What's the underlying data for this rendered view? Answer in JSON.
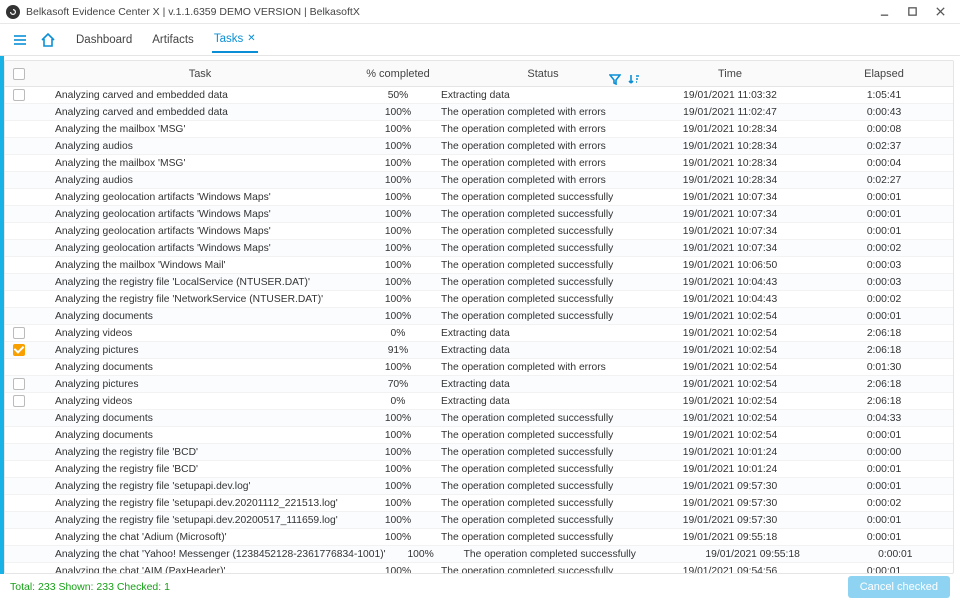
{
  "window": {
    "title": "Belkasoft Evidence Center X | v.1.1.6359 DEMO VERSION | BelkasoftX"
  },
  "tabs": {
    "dashboard": "Dashboard",
    "artifacts": "Artifacts",
    "tasks": "Tasks"
  },
  "columns": {
    "task": "Task",
    "pct": "% completed",
    "status": "Status",
    "time": "Time",
    "elapsed": "Elapsed"
  },
  "footer": {
    "stats": "Total: 233  Shown: 233  Checked: 1",
    "cancel": "Cancel checked"
  },
  "rows": [
    {
      "chk": "empty",
      "task": "Analyzing carved and embedded data",
      "pct": "50%",
      "status": "Extracting data",
      "time": "19/01/2021 11:03:32",
      "elapsed": "1:05:41"
    },
    {
      "chk": "none",
      "task": "Analyzing carved and embedded data",
      "pct": "100%",
      "status": "The operation completed with errors",
      "time": "19/01/2021 11:02:47",
      "elapsed": "0:00:43"
    },
    {
      "chk": "none",
      "task": "Analyzing the mailbox 'MSG'",
      "pct": "100%",
      "status": "The operation completed with errors",
      "time": "19/01/2021 10:28:34",
      "elapsed": "0:00:08"
    },
    {
      "chk": "none",
      "task": "Analyzing audios",
      "pct": "100%",
      "status": "The operation completed with errors",
      "time": "19/01/2021 10:28:34",
      "elapsed": "0:02:37"
    },
    {
      "chk": "none",
      "task": "Analyzing the mailbox 'MSG'",
      "pct": "100%",
      "status": "The operation completed with errors",
      "time": "19/01/2021 10:28:34",
      "elapsed": "0:00:04"
    },
    {
      "chk": "none",
      "task": "Analyzing audios",
      "pct": "100%",
      "status": "The operation completed with errors",
      "time": "19/01/2021 10:28:34",
      "elapsed": "0:02:27"
    },
    {
      "chk": "none",
      "task": "Analyzing geolocation artifacts 'Windows Maps'",
      "pct": "100%",
      "status": "The operation completed successfully",
      "time": "19/01/2021 10:07:34",
      "elapsed": "0:00:01"
    },
    {
      "chk": "none",
      "task": "Analyzing geolocation artifacts 'Windows Maps'",
      "pct": "100%",
      "status": "The operation completed successfully",
      "time": "19/01/2021 10:07:34",
      "elapsed": "0:00:01"
    },
    {
      "chk": "none",
      "task": "Analyzing geolocation artifacts 'Windows Maps'",
      "pct": "100%",
      "status": "The operation completed successfully",
      "time": "19/01/2021 10:07:34",
      "elapsed": "0:00:01"
    },
    {
      "chk": "none",
      "task": "Analyzing geolocation artifacts 'Windows Maps'",
      "pct": "100%",
      "status": "The operation completed successfully",
      "time": "19/01/2021 10:07:34",
      "elapsed": "0:00:02"
    },
    {
      "chk": "none",
      "task": "Analyzing the mailbox 'Windows Mail'",
      "pct": "100%",
      "status": "The operation completed successfully",
      "time": "19/01/2021 10:06:50",
      "elapsed": "0:00:03"
    },
    {
      "chk": "none",
      "task": "Analyzing the registry file 'LocalService (NTUSER.DAT)'",
      "pct": "100%",
      "status": "The operation completed successfully",
      "time": "19/01/2021 10:04:43",
      "elapsed": "0:00:03"
    },
    {
      "chk": "none",
      "task": "Analyzing the registry file 'NetworkService (NTUSER.DAT)'",
      "pct": "100%",
      "status": "The operation completed successfully",
      "time": "19/01/2021 10:04:43",
      "elapsed": "0:00:02"
    },
    {
      "chk": "none",
      "task": "Analyzing documents",
      "pct": "100%",
      "status": "The operation completed successfully",
      "time": "19/01/2021 10:02:54",
      "elapsed": "0:00:01"
    },
    {
      "chk": "empty",
      "task": "Analyzing videos",
      "pct": "0%",
      "status": "Extracting data",
      "time": "19/01/2021 10:02:54",
      "elapsed": "2:06:18"
    },
    {
      "chk": "checked",
      "task": "Analyzing pictures",
      "pct": "91%",
      "status": "Extracting data",
      "time": "19/01/2021 10:02:54",
      "elapsed": "2:06:18"
    },
    {
      "chk": "none",
      "task": "Analyzing documents",
      "pct": "100%",
      "status": "The operation completed with errors",
      "time": "19/01/2021 10:02:54",
      "elapsed": "0:01:30"
    },
    {
      "chk": "empty",
      "task": "Analyzing pictures",
      "pct": "70%",
      "status": "Extracting data",
      "time": "19/01/2021 10:02:54",
      "elapsed": "2:06:18"
    },
    {
      "chk": "empty",
      "task": "Analyzing videos",
      "pct": "0%",
      "status": "Extracting data",
      "time": "19/01/2021 10:02:54",
      "elapsed": "2:06:18"
    },
    {
      "chk": "none",
      "task": "Analyzing documents",
      "pct": "100%",
      "status": "The operation completed successfully",
      "time": "19/01/2021 10:02:54",
      "elapsed": "0:04:33"
    },
    {
      "chk": "none",
      "task": "Analyzing documents",
      "pct": "100%",
      "status": "The operation completed successfully",
      "time": "19/01/2021 10:02:54",
      "elapsed": "0:00:01"
    },
    {
      "chk": "none",
      "task": "Analyzing the registry file 'BCD'",
      "pct": "100%",
      "status": "The operation completed successfully",
      "time": "19/01/2021 10:01:24",
      "elapsed": "0:00:00"
    },
    {
      "chk": "none",
      "task": "Analyzing the registry file 'BCD'",
      "pct": "100%",
      "status": "The operation completed successfully",
      "time": "19/01/2021 10:01:24",
      "elapsed": "0:00:01"
    },
    {
      "chk": "none",
      "task": "Analyzing the registry file 'setupapi.dev.log'",
      "pct": "100%",
      "status": "The operation completed successfully",
      "time": "19/01/2021 09:57:30",
      "elapsed": "0:00:01"
    },
    {
      "chk": "none",
      "task": "Analyzing the registry file 'setupapi.dev.20201112_221513.log'",
      "pct": "100%",
      "status": "The operation completed successfully",
      "time": "19/01/2021 09:57:30",
      "elapsed": "0:00:02"
    },
    {
      "chk": "none",
      "task": "Analyzing the registry file 'setupapi.dev.20200517_111659.log'",
      "pct": "100%",
      "status": "The operation completed successfully",
      "time": "19/01/2021 09:57:30",
      "elapsed": "0:00:01"
    },
    {
      "chk": "none",
      "task": "Analyzing the chat 'Adium (Microsoft)'",
      "pct": "100%",
      "status": "The operation completed successfully",
      "time": "19/01/2021 09:55:18",
      "elapsed": "0:00:01"
    },
    {
      "chk": "none",
      "task": "Analyzing the chat 'Yahoo! Messenger (1238452128-2361776834-1001)'",
      "pct": "100%",
      "status": "The operation completed successfully",
      "time": "19/01/2021 09:55:18",
      "elapsed": "0:00:01"
    },
    {
      "chk": "none",
      "task": "Analyzing the chat 'AIM (PaxHeader)'",
      "pct": "100%",
      "status": "The operation completed successfully",
      "time": "19/01/2021 09:54:56",
      "elapsed": "0:00:01"
    }
  ]
}
